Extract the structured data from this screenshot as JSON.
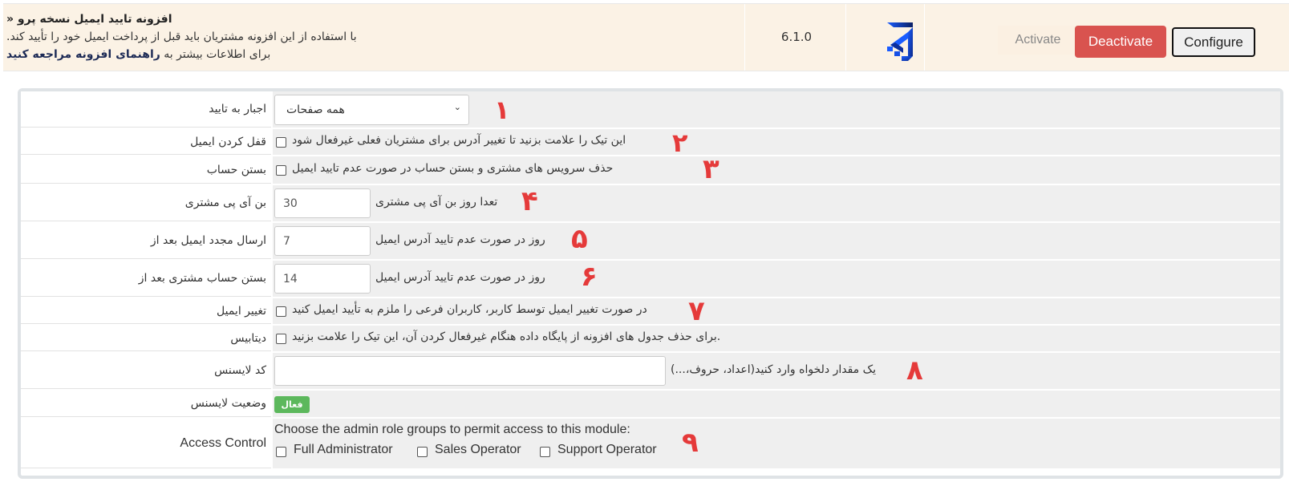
{
  "module": {
    "title": "افزونه تایید ایمیل نسخه پرو «",
    "description": ".با استفاده از این افزونه مشتریان باید قبل از پرداخت ایمیل خود را تأیید کند",
    "info_prefix": "برای اطلاعات بیشتر به ",
    "info_link": "راهنمای افزونه مراجعه کنید",
    "version": "6.1.0",
    "logo_icon": "brand-logo-icon",
    "buttons": {
      "activate": "Activate",
      "deactivate": "Deactivate",
      "configure": "Configure"
    },
    "colors": {
      "row_bg": "#fbf2e5",
      "deactivate": "#d9534f"
    }
  },
  "config": {
    "annotation_color": "#e53a3a",
    "rows": [
      {
        "label": "اجبار به تایید",
        "type": "select",
        "selected": "همه صفحات",
        "annotation": "۱"
      },
      {
        "label": "قفل کردن ایمیل",
        "type": "checkbox",
        "checked": false,
        "text": "این تیک را علامت بزنید تا تغییر آدرس برای مشتریان فعلی غیرفعال شود",
        "annotation": "۲"
      },
      {
        "label": "بستن حساب",
        "type": "checkbox",
        "checked": false,
        "text": "حذف سرویس های مشتری و بستن حساب در صورت عدم تایید ایمیل",
        "annotation": "۳"
      },
      {
        "label": "بن آی پی مشتری",
        "type": "text",
        "value": "30",
        "text": "تعدا روز بن آی پی مشتری",
        "annotation": "۴"
      },
      {
        "label": "ارسال مجدد ایمیل بعد از",
        "type": "text",
        "value": "7",
        "text": "روز در صورت عدم تایید آدرس ایمیل",
        "annotation": "۵"
      },
      {
        "label": "بستن حساب مشتری بعد از",
        "type": "text",
        "value": "14",
        "text": "روز در صورت عدم تایید آدرس ایمیل",
        "annotation": "۶"
      },
      {
        "label": "تغییر ایمیل",
        "type": "checkbox",
        "checked": false,
        "text": "در صورت تغییر ایمیل توسط کاربر، کاربران فرعی را ملزم به تأیید ایمیل کنید",
        "annotation": "۷"
      },
      {
        "label": "دیتابیس",
        "type": "checkbox",
        "checked": false,
        "text": ".برای حذف جدول های افزونه از پایگاه داده هنگام غیرفعال کردن آن، این تیک را علامت بزنید",
        "annotation": ""
      },
      {
        "label": "کد لایسنس",
        "type": "text",
        "value": "",
        "text": "یک مقدار دلخواه وارد کنید(اعداد، حروف،...)",
        "annotation": "۸"
      },
      {
        "label": "وضعیت لایسنس",
        "type": "badge",
        "badge": "فعال",
        "badge_color": "#5cb85c"
      },
      {
        "label": "Access Control",
        "type": "access",
        "text": "Choose the admin role groups to permit access to this module:",
        "options": [
          {
            "label": "Full Administrator",
            "checked": false
          },
          {
            "label": "Sales Operator",
            "checked": false
          },
          {
            "label": "Support Operator",
            "checked": false
          }
        ],
        "annotation": "۹"
      }
    ]
  }
}
